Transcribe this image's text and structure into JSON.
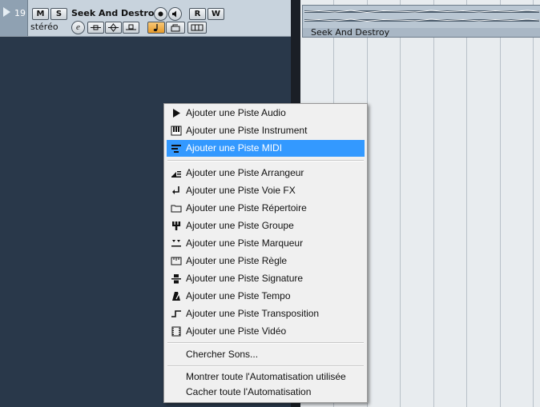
{
  "track": {
    "number": "19",
    "mute_label": "M",
    "solo_label": "S",
    "name": "Seek And Destroy",
    "read_label": "R",
    "write_label": "W",
    "format": "stéréo",
    "edit_label": "e"
  },
  "event": {
    "label": "Seek And Destroy"
  },
  "menu": {
    "items": [
      {
        "label": "Ajouter une Piste Audio",
        "icon": "play-arrow-icon"
      },
      {
        "label": "Ajouter une Piste Instrument",
        "icon": "keyboard-icon"
      },
      {
        "label": "Ajouter une Piste MIDI",
        "icon": "midi-lines-icon",
        "selected": true
      },
      {
        "label": "Ajouter une Piste Arrangeur",
        "icon": "arranger-icon"
      },
      {
        "label": "Ajouter une Piste Voie FX",
        "icon": "fx-return-icon"
      },
      {
        "label": "Ajouter une Piste Répertoire",
        "icon": "folder-icon"
      },
      {
        "label": "Ajouter une Piste Groupe",
        "icon": "group-icon"
      },
      {
        "label": "Ajouter une Piste Marqueur",
        "icon": "marker-icon"
      },
      {
        "label": "Ajouter une Piste Règle",
        "icon": "ruler-icon"
      },
      {
        "label": "Ajouter une Piste Signature",
        "icon": "signature-icon"
      },
      {
        "label": "Ajouter une Piste Tempo",
        "icon": "metronome-icon"
      },
      {
        "label": "Ajouter une Piste Transposition",
        "icon": "transpose-icon"
      },
      {
        "label": "Ajouter une Piste Vidéo",
        "icon": "video-icon"
      },
      {
        "label": "Chercher Sons..."
      },
      {
        "label": "Montrer toute l'Automatisation utilisée"
      },
      {
        "label": "Cacher toute l'Automatisation"
      }
    ]
  },
  "colors": {
    "background": "#29384a",
    "selection": "#3399ff",
    "monitor_active": "#f0b04a"
  }
}
